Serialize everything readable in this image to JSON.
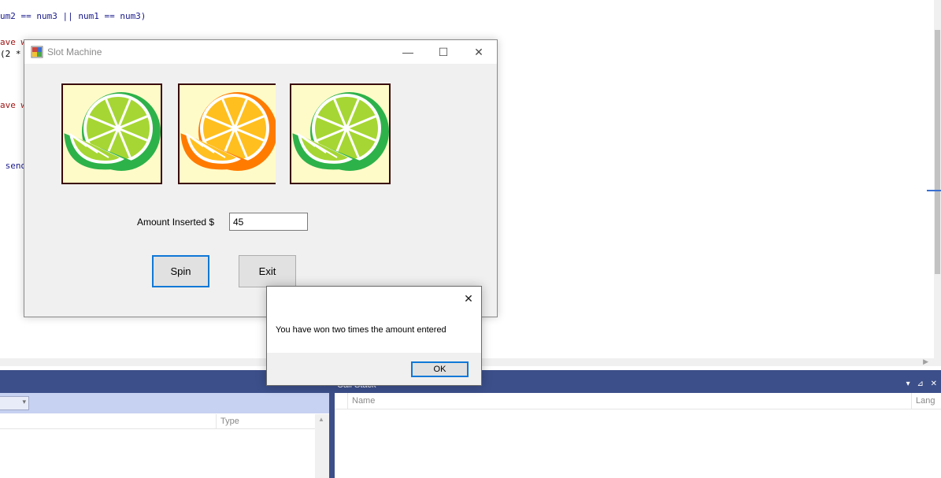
{
  "code_editor": {
    "lines": [
      {
        "parts": [
          {
            "text": "um2 == num3 || num1 == num3)",
            "kind": "kw"
          }
        ]
      },
      {
        "parts": [
          {
            "text": "ave w",
            "kind": "str"
          }
        ]
      },
      {
        "parts": [
          {
            "text": "(2 *",
            "kind": "plain"
          }
        ]
      },
      {
        "parts": [
          {
            "text": "ave w",
            "kind": "str"
          }
        ]
      },
      {
        "parts": [
          {
            "text": " send",
            "kind": "kw"
          }
        ]
      }
    ]
  },
  "slot_window": {
    "title": "Slot Machine",
    "caption_buttons": {
      "minimize": "—",
      "maximize": "☐",
      "close": "✕"
    },
    "reels": [
      {
        "fruit": "lime",
        "colors": {
          "rind": "#2db24a",
          "flesh": "#a6d633",
          "fill": "#ffffff"
        }
      },
      {
        "fruit": "orange",
        "colors": {
          "rind": "#ff7b00",
          "flesh": "#ffbf1f",
          "fill": "#ffffff"
        }
      },
      {
        "fruit": "lime",
        "colors": {
          "rind": "#2db24a",
          "flesh": "#a6d633",
          "fill": "#ffffff"
        }
      }
    ],
    "amount_label": "Amount Inserted $",
    "amount_value": "45",
    "spin_label": "Spin",
    "exit_label": "Exit"
  },
  "message_box": {
    "message": "You have won two times the amount entered",
    "ok_label": "OK",
    "close_glyph": "✕"
  },
  "panels": {
    "call_stack_title": "Call Stack",
    "call_stack_icons": "▾ ⊿ ✕",
    "call_stack_columns": [
      "Name",
      "Lang"
    ],
    "autos_columns": [
      "Type"
    ],
    "autos_pin": "✕"
  },
  "accent_color": "#0f78d7",
  "panel_color": "#3c4f8a"
}
